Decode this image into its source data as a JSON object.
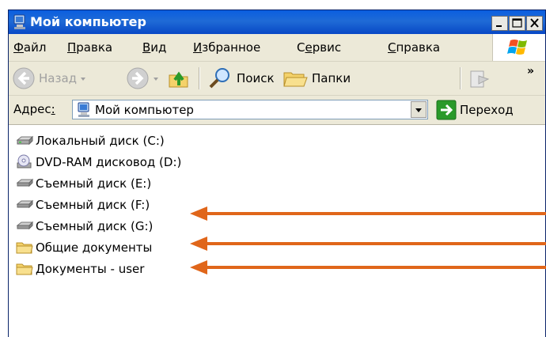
{
  "window": {
    "title": "Мой компьютер"
  },
  "menu": [
    {
      "pre": "",
      "acc": "Ф",
      "post": "айл"
    },
    {
      "pre": "",
      "acc": "П",
      "post": "равка"
    },
    {
      "pre": "",
      "acc": "В",
      "post": "ид"
    },
    {
      "pre": "",
      "acc": "И",
      "post": "збранное"
    },
    {
      "pre": "С",
      "acc": "е",
      "post": "рвис"
    },
    {
      "pre": "",
      "acc": "С",
      "post": "правка"
    }
  ],
  "toolbar": {
    "back_label": "Назад",
    "search_label": "Поиск",
    "folders_label": "Папки",
    "chevron": "»"
  },
  "address": {
    "label": "Адрес",
    "label_acc": ":",
    "value": "Мой компьютер",
    "go_label": "Переход"
  },
  "items": [
    {
      "label": "Локальный диск (C:)",
      "icon": "hard-drive-icon"
    },
    {
      "label": "DVD-RAM дисковод (D:)",
      "icon": "dvd-drive-icon"
    },
    {
      "label": "Съемный диск (E:)",
      "icon": "removable-drive-icon"
    },
    {
      "label": "Съемный диск (F:)",
      "icon": "removable-drive-icon"
    },
    {
      "label": "Съемный диск (G:)",
      "icon": "removable-drive-icon"
    },
    {
      "label": "Общие документы",
      "icon": "folder-icon"
    },
    {
      "label": "Документы - user",
      "icon": "folder-icon"
    }
  ],
  "colors": {
    "titlebar": "#0a5ee0",
    "arrow": "#e0661a",
    "go_green": "#2a9a2a"
  }
}
